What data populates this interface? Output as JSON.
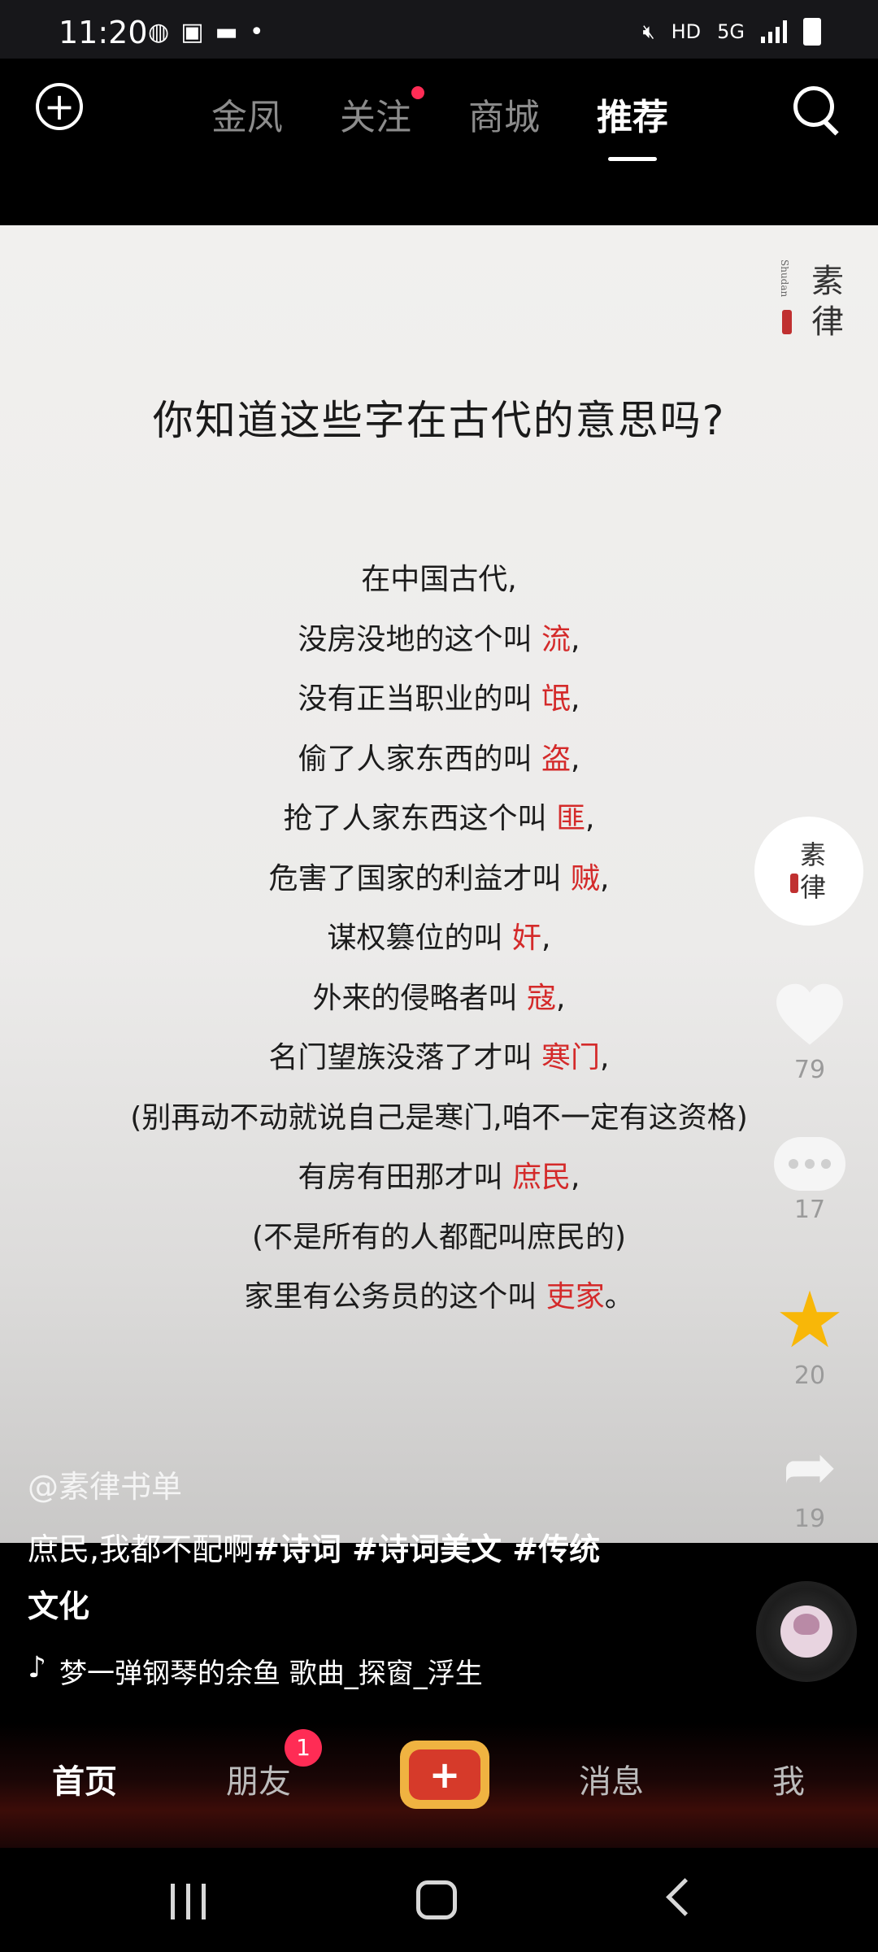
{
  "status": {
    "time": "11:20",
    "network": "HD",
    "gen": "5G"
  },
  "topnav": {
    "tabs": [
      "金凤",
      "关注",
      "商城",
      "推荐"
    ],
    "active": "推荐"
  },
  "post": {
    "seal_cn": [
      "素",
      "律"
    ],
    "seal_en": "Shudan",
    "title": "你知道这些字在古代的意思吗?",
    "lines": [
      {
        "pre": "在中国古代,",
        "red": "",
        "post": ""
      },
      {
        "pre": "没房没地的这个叫 ",
        "red": "流",
        "post": ","
      },
      {
        "pre": "没有正当职业的叫 ",
        "red": "氓",
        "post": ","
      },
      {
        "pre": "偷了人家东西的叫 ",
        "red": "盗",
        "post": ","
      },
      {
        "pre": "抢了人家东西这个叫 ",
        "red": "匪",
        "post": ","
      },
      {
        "pre": "危害了国家的利益才叫 ",
        "red": "贼",
        "post": ","
      },
      {
        "pre": "谋权篡位的叫 ",
        "red": "奸",
        "post": ","
      },
      {
        "pre": "外来的侵略者叫 ",
        "red": "寇",
        "post": ","
      },
      {
        "pre": "名门望族没落了才叫 ",
        "red": "寒门",
        "post": ","
      },
      {
        "pre": "(别再动不动就说自己是寒门,咱不一定有这资格)",
        "red": "",
        "post": ""
      },
      {
        "pre": "有房有田那才叫 ",
        "red": "庶民",
        "post": ","
      },
      {
        "pre": "(不是所有的人都配叫庶民的)",
        "red": "",
        "post": ""
      },
      {
        "pre": "家里有公务员的这个叫 ",
        "red": "吏家",
        "post": "。"
      }
    ],
    "author": "@素律书单",
    "caption_plain": "庶民,我都不配啊",
    "caption_tags": "#诗词 #诗词美文 #传统",
    "caption_tail": "文化",
    "music": "梦一弹钢琴的余鱼    歌曲_探窗_浮生"
  },
  "actions": {
    "likes": "79",
    "comments": "17",
    "favorites": "20",
    "shares": "19"
  },
  "colors": {
    "highlight": "#d42a2a",
    "badge": "#ff2c55",
    "star": "#f8b708"
  },
  "bottomnav": {
    "home": "首页",
    "friends": "朋友",
    "friends_badge": "1",
    "create": "+",
    "messages": "消息",
    "me": "我"
  }
}
